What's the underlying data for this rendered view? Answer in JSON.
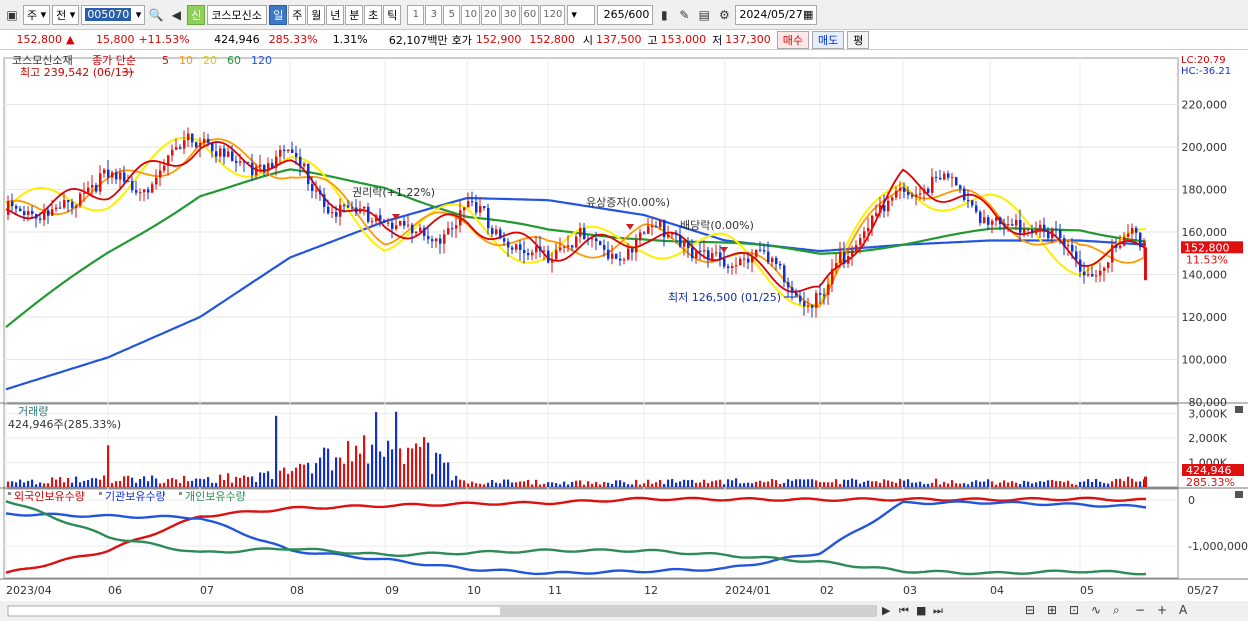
{
  "toolbar": {
    "type_label": "주",
    "prev_label": "전",
    "code": "005070",
    "name": "코스모신소",
    "badge": "신",
    "periods": [
      "일",
      "주",
      "월",
      "년",
      "분",
      "초",
      "틱"
    ],
    "active_period": "일",
    "minute_options": [
      "1",
      "3",
      "5",
      "10",
      "20",
      "30",
      "60",
      "120"
    ],
    "count": "265",
    "count_total": "/600",
    "date": "2024/05/27"
  },
  "quote": {
    "price": "152,800",
    "arrow": "▲",
    "change": "15,800",
    "change_pct": "+11.53%",
    "volume": "424,946",
    "volume_ratio": "285.33%",
    "turnover_pct": "1.31%",
    "amount": "62,107백만",
    "ask_label": "호가",
    "ask1": "152,900",
    "ask2": "152,800",
    "open_label": "시",
    "open": "137,500",
    "high_label": "고",
    "high": "153,000",
    "low_label": "저",
    "low": "137,300",
    "buy_label": "매수",
    "sell_label": "매도",
    "eval_label": "평"
  },
  "chart": {
    "legend_name": "코스모신소재",
    "legend_type": "종가 단순",
    "ma_periods": [
      "5",
      "10",
      "20",
      "60",
      "120"
    ],
    "ma_colors": [
      "#dd0000",
      "#ff9900",
      "#ffee00",
      "#229933",
      "#2255dd"
    ],
    "high_marker": "최고 239,542 (06/13)",
    "low_marker": "최저 126,500 (01/25)",
    "annotations": [
      "권리락(+1.22%)",
      "유상증자(0.00%)",
      "배당락(0.00%)"
    ],
    "lc": "LC:20.79",
    "hc": "HC:-36.21",
    "price_ticks": [
      "220,000",
      "200,000",
      "180,000",
      "160,000",
      "140,000",
      "120,000",
      "100,000",
      "80,000"
    ],
    "last_price_label": "152,800",
    "last_pct_label": "11.53%",
    "volume_title": "거래량",
    "volume_info": "424,946주(285.33%)",
    "volume_ticks": [
      "3,000K",
      "2,000K",
      "1,000K"
    ],
    "volume_last": "424,946",
    "volume_last_pct": "285.33%",
    "holdings_titles": [
      "외국인보유수량",
      "기관보유수량",
      "개인보유수량"
    ],
    "holdings_ticks": [
      "0",
      "-1,000,000"
    ],
    "date_labels": [
      "2023/04",
      "06",
      "07",
      "08",
      "09",
      "10",
      "11",
      "12",
      "2024/01",
      "02",
      "03",
      "04",
      "05",
      "05/27"
    ]
  },
  "chart_data": {
    "type": "line",
    "x": [
      "2023/04",
      "06",
      "07",
      "08",
      "09",
      "10",
      "11",
      "12",
      "2024/01",
      "02",
      "03",
      "04",
      "05",
      "05/27"
    ],
    "series": [
      {
        "name": "120",
        "values": [
          86000,
          101000,
          120000,
          148000,
          165000,
          176000,
          175000,
          168000,
          156000,
          151000,
          154000,
          156000,
          156000,
          154000
        ]
      },
      {
        "name": "60",
        "values": [
          115000,
          150000,
          178000,
          188000,
          182000,
          167000,
          160000,
          158000,
          154000,
          150000,
          155000,
          160000,
          162000,
          156000
        ]
      },
      {
        "name": "5",
        "values": [
          168000,
          180000,
          200000,
          190000,
          160000,
          165000,
          150000,
          158000,
          150000,
          130000,
          185000,
          170000,
          148000,
          152800
        ]
      }
    ],
    "ylim": [
      80000,
      240000
    ],
    "volume": [
      250000,
      420000,
      380000,
      700000,
      2900000,
      250000,
      240000,
      260000,
      300000,
      260000,
      310000,
      250000,
      240000,
      424946
    ],
    "holdings_foreign": [
      -1600000,
      -1100000,
      -350000,
      -180000,
      -120000,
      -80000,
      -60000,
      30000,
      20000,
      10000,
      20000,
      10000,
      30000,
      0
    ],
    "holdings_institution": [
      -300000,
      -350000,
      -380000,
      -1100000,
      -1300000,
      -1500000,
      -1600000,
      -1550000,
      -1500000,
      -1150000,
      -60000,
      -50000,
      -100000,
      -150000
    ],
    "holdings_individual": [
      0,
      -800000,
      -1150000,
      -1050000,
      -1200000,
      -1150000,
      -1100000,
      -1100000,
      -1200000,
      -1350000,
      -1550000,
      -1600000,
      -1550000,
      -1600000
    ]
  }
}
